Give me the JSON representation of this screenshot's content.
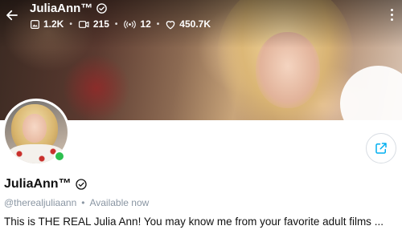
{
  "header": {
    "title": "JuliaAnn™",
    "stats": [
      {
        "icon": "image-icon",
        "value": "1.2K"
      },
      {
        "icon": "video-icon",
        "value": "215"
      },
      {
        "icon": "live-stream-icon",
        "value": "12"
      },
      {
        "icon": "heart-icon",
        "value": "450.7K"
      }
    ]
  },
  "profile": {
    "name": "JuliaAnn™",
    "handle": "@therealjuliaann",
    "status": "Available now",
    "bio": "This is THE REAL Julia Ann! You may know me from your favorite adult films ..."
  },
  "colors": {
    "online": "#2dbf4f",
    "accent": "#00aff0",
    "muted": "#8a96a3"
  }
}
